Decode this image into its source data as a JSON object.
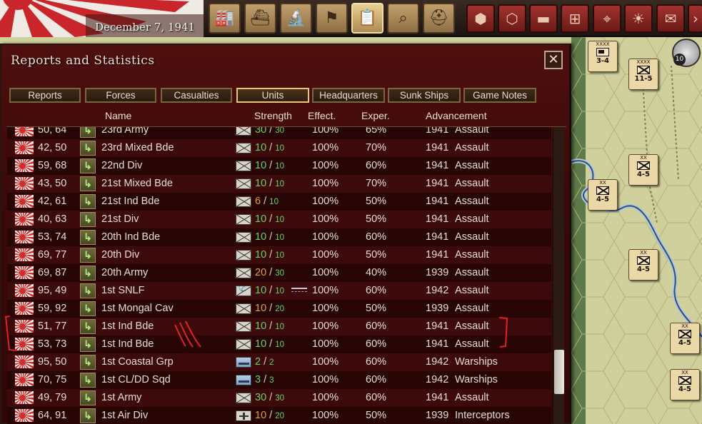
{
  "topbar": {
    "date": "December 7, 1941",
    "buttons": [
      {
        "name": "production-button",
        "glyph": "🏭"
      },
      {
        "name": "naval-button",
        "glyph": "⛴"
      },
      {
        "name": "research-button",
        "glyph": "🔬"
      },
      {
        "name": "objectives-button",
        "glyph": "⚑"
      },
      {
        "name": "reports-button",
        "glyph": "📋",
        "active": true
      },
      {
        "name": "intelligence-button",
        "glyph": "⌕"
      },
      {
        "name": "army-button",
        "glyph": "⛑"
      }
    ],
    "map_buttons": [
      {
        "name": "hex-button",
        "glyph": "⬢"
      },
      {
        "name": "hex-grid-button",
        "glyph": "⬡"
      },
      {
        "name": "supply-train-button",
        "glyph": "▬"
      },
      {
        "name": "resources-button",
        "glyph": "⊞"
      },
      {
        "name": "target-button",
        "glyph": "⌖"
      },
      {
        "name": "weather-button",
        "glyph": "☀"
      },
      {
        "name": "mail-button",
        "glyph": "✉"
      },
      {
        "name": "more-button",
        "glyph": "›"
      }
    ]
  },
  "dialog": {
    "title": "Reports and Statistics",
    "close_label": "✕",
    "tabs": [
      "Reports",
      "Forces",
      "Casualties",
      "Units",
      "Headquarters",
      "Sunk Ships",
      "Game Notes"
    ],
    "active_tab": "Units",
    "columns": {
      "name": "Name",
      "strength": "Strength",
      "effect": "Effect.",
      "exper": "Exper.",
      "advancement": "Advancement"
    },
    "rows": [
      {
        "coords": "50, 64",
        "name": "23rd Army",
        "type": "inf",
        "str": "30",
        "max": "30",
        "str_color": "green",
        "effect": "100%",
        "exper": "65%",
        "year": "1941",
        "adv": "Assault"
      },
      {
        "coords": "42, 50",
        "name": "23rd Mixed Bde",
        "type": "inf",
        "str": "10",
        "max": "10",
        "str_color": "green",
        "effect": "100%",
        "exper": "70%",
        "year": "1941",
        "adv": "Assault"
      },
      {
        "coords": "59, 68",
        "name": "22nd Div",
        "type": "inf",
        "str": "10",
        "max": "10",
        "str_color": "green",
        "effect": "100%",
        "exper": "60%",
        "year": "1941",
        "adv": "Assault"
      },
      {
        "coords": "43, 50",
        "name": "21st Mixed Bde",
        "type": "inf",
        "str": "10",
        "max": "10",
        "str_color": "green",
        "effect": "100%",
        "exper": "70%",
        "year": "1941",
        "adv": "Assault"
      },
      {
        "coords": "42, 61",
        "name": "21st Ind Bde",
        "type": "inf",
        "str": "6",
        "max": "10",
        "str_color": "orange",
        "effect": "100%",
        "exper": "50%",
        "year": "1941",
        "adv": "Assault"
      },
      {
        "coords": "40, 63",
        "name": "21st Div",
        "type": "inf",
        "str": "10",
        "max": "10",
        "str_color": "green",
        "effect": "100%",
        "exper": "50%",
        "year": "1941",
        "adv": "Assault"
      },
      {
        "coords": "53, 74",
        "name": "20th Ind Bde",
        "type": "inf",
        "str": "10",
        "max": "10",
        "str_color": "green",
        "effect": "100%",
        "exper": "60%",
        "year": "1941",
        "adv": "Assault"
      },
      {
        "coords": "69, 77",
        "name": "20th Div",
        "type": "inf",
        "str": "10",
        "max": "10",
        "str_color": "green",
        "effect": "100%",
        "exper": "50%",
        "year": "1941",
        "adv": "Assault"
      },
      {
        "coords": "69, 87",
        "name": "20th Army",
        "type": "inf",
        "str": "20",
        "max": "30",
        "str_color": "orange",
        "effect": "100%",
        "exper": "40%",
        "year": "1939",
        "adv": "Assault"
      },
      {
        "coords": "95, 49",
        "name": "1st SNLF",
        "type": "snlf",
        "str": "10",
        "max": "10",
        "str_color": "green",
        "effect": "100%",
        "exper": "60%",
        "year": "1942",
        "adv": "Assault",
        "ship": true
      },
      {
        "coords": "59, 92",
        "name": "1st Mongal Cav",
        "type": "cav",
        "str": "10",
        "max": "20",
        "str_color": "orange",
        "effect": "100%",
        "exper": "50%",
        "year": "1939",
        "adv": "Assault"
      },
      {
        "coords": "51, 77",
        "name": "1st Ind Bde",
        "type": "inf",
        "str": "10",
        "max": "10",
        "str_color": "green",
        "effect": "100%",
        "exper": "60%",
        "year": "1941",
        "adv": "Assault"
      },
      {
        "coords": "53, 73",
        "name": "1st Ind Bde",
        "type": "inf",
        "str": "10",
        "max": "10",
        "str_color": "green",
        "effect": "100%",
        "exper": "60%",
        "year": "1941",
        "adv": "Assault"
      },
      {
        "coords": "95, 50",
        "name": "1st Coastal Grp",
        "type": "ship",
        "str": "2",
        "max": "2",
        "str_color": "green",
        "effect": "100%",
        "exper": "60%",
        "year": "1942",
        "adv": "Warships"
      },
      {
        "coords": "70, 75",
        "name": "1st CL/DD Sqd",
        "type": "ship",
        "str": "3",
        "max": "3",
        "str_color": "green",
        "effect": "100%",
        "exper": "60%",
        "year": "1942",
        "adv": "Warships"
      },
      {
        "coords": "49, 79",
        "name": "1st Army",
        "type": "inf",
        "str": "30",
        "max": "30",
        "str_color": "green",
        "effect": "100%",
        "exper": "60%",
        "year": "1941",
        "adv": "Assault"
      },
      {
        "coords": "64, 91",
        "name": "1st Air Div",
        "type": "air",
        "str": "10",
        "max": "20",
        "str_color": "orange",
        "effect": "100%",
        "exper": "50%",
        "year": "1939",
        "adv": "Interceptors"
      }
    ],
    "scroll_position": 0.78
  },
  "map": {
    "stack_count": "10",
    "counters": [
      {
        "size": "XXXX",
        "value": "3-4",
        "armored": true
      },
      {
        "size": "XXXX",
        "value": "11-5"
      },
      {
        "size": "XX",
        "value": "4-5"
      },
      {
        "size": "XX",
        "value": "4-5"
      },
      {
        "size": "XX",
        "value": "4-5"
      },
      {
        "size": "XX",
        "value": "4-5"
      },
      {
        "size": "XX",
        "value": "4-5"
      }
    ]
  }
}
